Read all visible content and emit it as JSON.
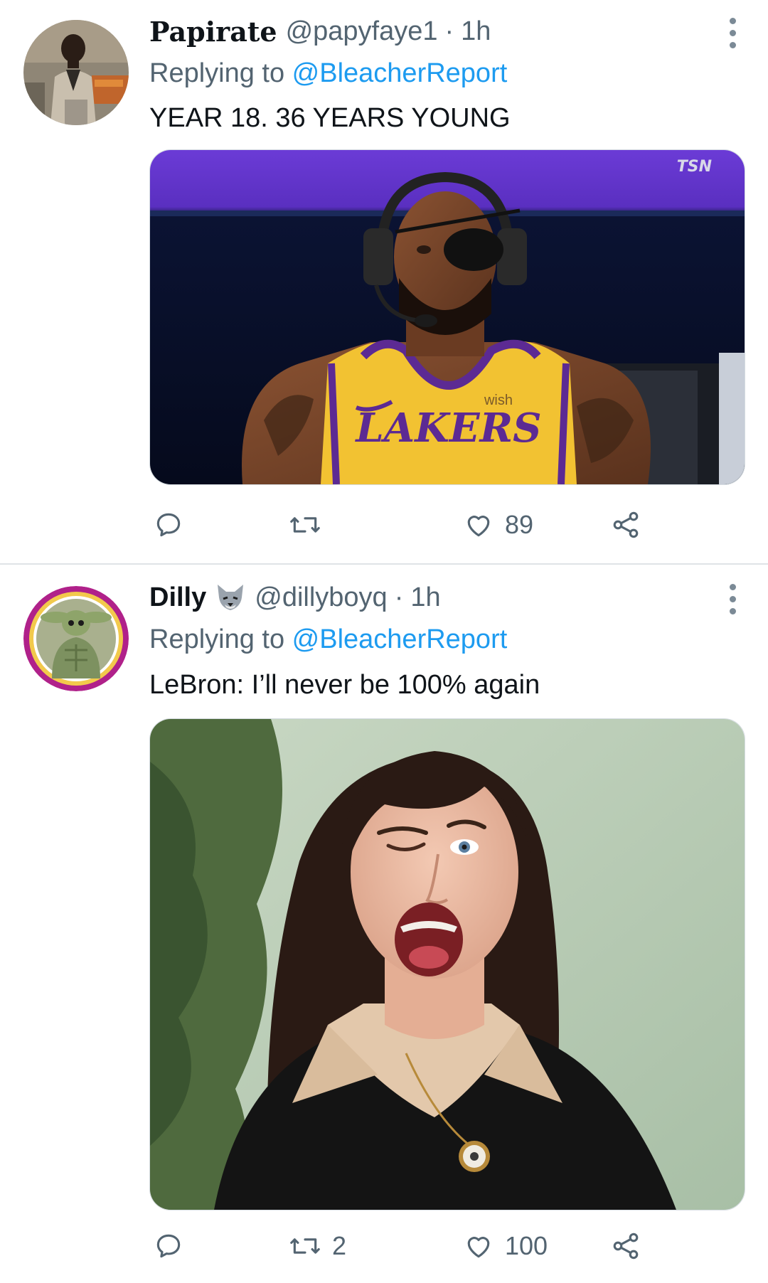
{
  "tweets": [
    {
      "name": "Papirate",
      "handle": "@papyfaye1",
      "separator": "·",
      "time": "1h",
      "replying_prefix": "Replying to ",
      "replying_to": "@BleacherReport",
      "text": "YEAR 18. 36 YEARS YOUNG",
      "media_overlay": {
        "broadcaster_logo": "TSN",
        "jersey_text": "LAKERS",
        "sponsor_text": "wish"
      },
      "actions": {
        "reply_icon": "reply-icon",
        "retweet_icon": "retweet-icon",
        "retweet_count": "",
        "like_icon": "heart-icon",
        "like_count": "89",
        "share_icon": "share-icon"
      }
    },
    {
      "name": "Dilly",
      "name_emoji": "wolf-emoji",
      "handle": "@dillyboyq",
      "separator": "·",
      "time": "1h",
      "replying_prefix": "Replying to ",
      "replying_to": "@BleacherReport",
      "text": "LeBron: I’ll never be 100% again",
      "actions": {
        "reply_icon": "reply-icon",
        "retweet_icon": "retweet-icon",
        "retweet_count": "2",
        "like_icon": "heart-icon",
        "like_count": "100",
        "share_icon": "share-icon"
      }
    }
  ],
  "colors": {
    "link": "#1d9bf0",
    "secondary_text": "#536471",
    "primary_text": "#0f1419",
    "divider": "#dfe3e6"
  }
}
